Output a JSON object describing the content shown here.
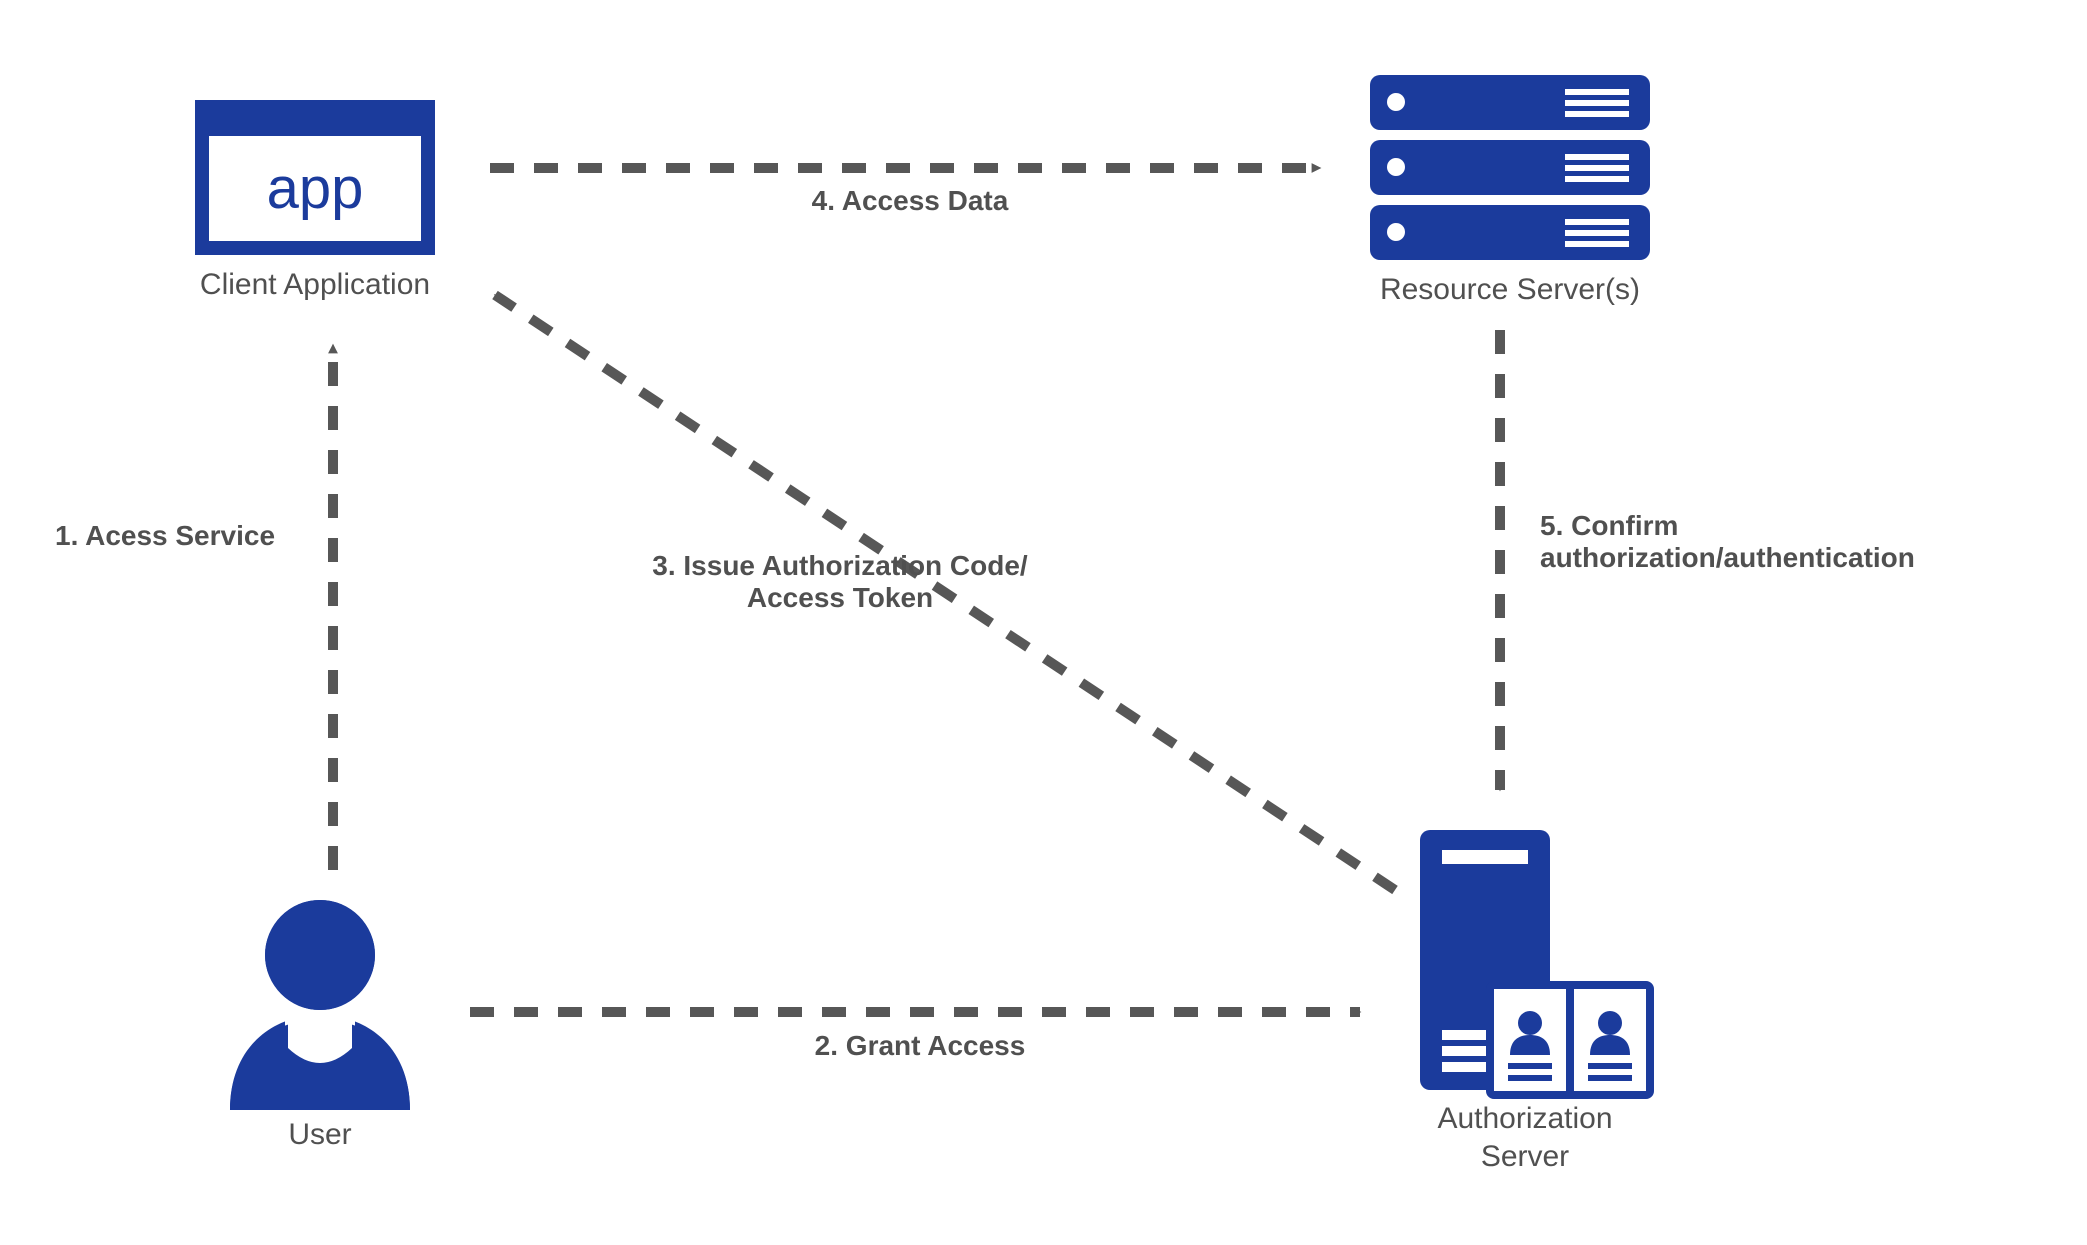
{
  "diagram": {
    "nodes": {
      "client_application": {
        "label": "Client Application",
        "icon_text": "app"
      },
      "resource_servers": {
        "label": "Resource Server(s)"
      },
      "user": {
        "label": "User"
      },
      "authorization_server": {
        "label": "Authorization",
        "label2": "Server"
      }
    },
    "edges": {
      "e1": {
        "label": "1. Acess Service"
      },
      "e2": {
        "label": "2. Grant Access"
      },
      "e3": {
        "label": "3. Issue Authorization Code/\nAccess Token"
      },
      "e4": {
        "label": "4. Access Data"
      },
      "e5": {
        "label": "5. Confirm\nauthorization/authentication"
      }
    },
    "colors": {
      "brand": "#1b3b9c",
      "arrow": "#575757",
      "text": "#505050"
    }
  }
}
